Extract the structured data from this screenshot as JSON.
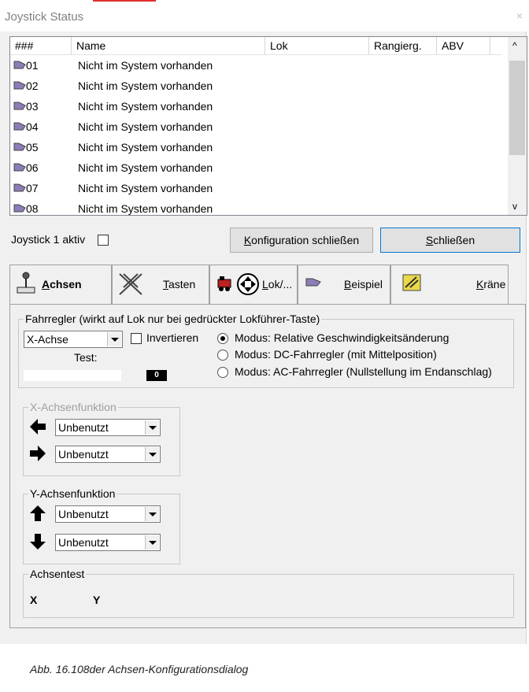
{
  "window": {
    "title": "Joystick Status",
    "close": "×"
  },
  "list": {
    "columns": [
      "###",
      "Name",
      "Lok",
      "Rangierg.",
      "ABV"
    ],
    "rows": [
      {
        "num": "01",
        "name": "Nicht im System vorhanden"
      },
      {
        "num": "02",
        "name": "Nicht im System vorhanden"
      },
      {
        "num": "03",
        "name": "Nicht im System vorhanden"
      },
      {
        "num": "04",
        "name": "Nicht im System vorhanden"
      },
      {
        "num": "05",
        "name": "Nicht im System vorhanden"
      },
      {
        "num": "06",
        "name": "Nicht im System vorhanden"
      },
      {
        "num": "07",
        "name": "Nicht im System vorhanden"
      },
      {
        "num": "08",
        "name": "Nicht im System vorhanden"
      }
    ],
    "scroll_up": "^",
    "scroll_down": "v"
  },
  "status": {
    "joystick_label": "Joystick 1 aktiv",
    "joystick_checked": false
  },
  "buttons": {
    "config_close_k": "K",
    "config_close_rest": "onfiguration schließen",
    "close_s": "S",
    "close_rest": "chließen"
  },
  "tabs": [
    {
      "key": "A",
      "rest": "chsen",
      "icon": "joystick-icon",
      "active": true
    },
    {
      "key": "T",
      "rest": "asten",
      "icon": "buttons-icon"
    },
    {
      "key": "L",
      "rest": "ok/...",
      "icon": "locomotive-icon"
    },
    {
      "key": "B",
      "rest": "eispiel",
      "icon": "joystick-small-icon"
    },
    {
      "key": "K",
      "rest": "räne",
      "icon": "crane-icon"
    }
  ],
  "fahrregler": {
    "label": "Fahrregler (wirkt auf Lok nur bei gedrückter Lokführer-Taste)",
    "axis": "X-Achse",
    "invert_label": "Invertieren",
    "invert_checked": false,
    "test_label": "Test:",
    "test_value": "0",
    "modes": [
      {
        "label": "Modus: Relative Geschwindigkeitsänderung",
        "selected": true
      },
      {
        "label": "Modus: DC-Fahrregler (mit Mittelposition)",
        "selected": false
      },
      {
        "label": "Modus: AC-Fahrregler (Nullstellung im Endanschlag)",
        "selected": false
      }
    ]
  },
  "x_function": {
    "label": "X-Achsenfunktion",
    "left": "Unbenutzt",
    "right": "Unbenutzt"
  },
  "y_function": {
    "label": "Y-Achsenfunktion",
    "up": "Unbenutzt",
    "down": "Unbenutzt"
  },
  "axis_test": {
    "label": "Achsentest",
    "x": "X",
    "y": "Y"
  },
  "caption": "Abb. 16.108der Achsen-Konfigurationsdialog",
  "colors": {
    "accent": "#0078d7",
    "background": "#f0f0f0"
  }
}
